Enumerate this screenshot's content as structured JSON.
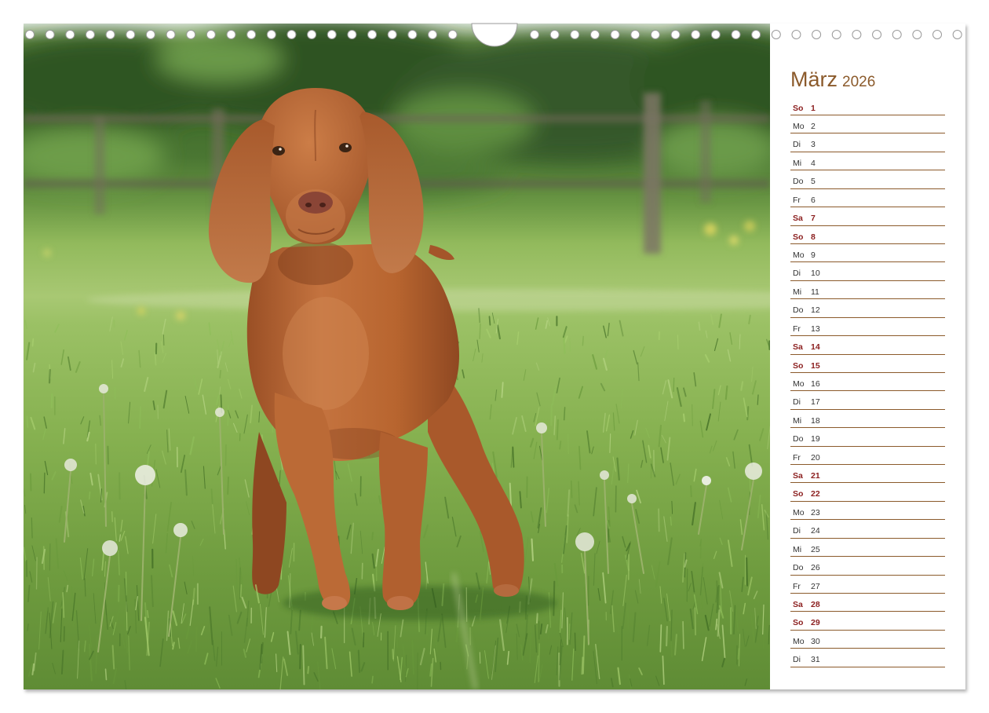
{
  "calendar": {
    "month": "März",
    "year": "2026",
    "days": [
      {
        "wd": "So",
        "d": "1",
        "weekend": true
      },
      {
        "wd": "Mo",
        "d": "2",
        "weekend": false
      },
      {
        "wd": "Di",
        "d": "3",
        "weekend": false
      },
      {
        "wd": "Mi",
        "d": "4",
        "weekend": false
      },
      {
        "wd": "Do",
        "d": "5",
        "weekend": false
      },
      {
        "wd": "Fr",
        "d": "6",
        "weekend": false
      },
      {
        "wd": "Sa",
        "d": "7",
        "weekend": true
      },
      {
        "wd": "So",
        "d": "8",
        "weekend": true
      },
      {
        "wd": "Mo",
        "d": "9",
        "weekend": false
      },
      {
        "wd": "Di",
        "d": "10",
        "weekend": false
      },
      {
        "wd": "Mi",
        "d": "11",
        "weekend": false
      },
      {
        "wd": "Do",
        "d": "12",
        "weekend": false
      },
      {
        "wd": "Fr",
        "d": "13",
        "weekend": false
      },
      {
        "wd": "Sa",
        "d": "14",
        "weekend": true
      },
      {
        "wd": "So",
        "d": "15",
        "weekend": true
      },
      {
        "wd": "Mo",
        "d": "16",
        "weekend": false
      },
      {
        "wd": "Di",
        "d": "17",
        "weekend": false
      },
      {
        "wd": "Mi",
        "d": "18",
        "weekend": false
      },
      {
        "wd": "Do",
        "d": "19",
        "weekend": false
      },
      {
        "wd": "Fr",
        "d": "20",
        "weekend": false
      },
      {
        "wd": "Sa",
        "d": "21",
        "weekend": true
      },
      {
        "wd": "So",
        "d": "22",
        "weekend": true
      },
      {
        "wd": "Mo",
        "d": "23",
        "weekend": false
      },
      {
        "wd": "Di",
        "d": "24",
        "weekend": false
      },
      {
        "wd": "Mi",
        "d": "25",
        "weekend": false
      },
      {
        "wd": "Do",
        "d": "26",
        "weekend": false
      },
      {
        "wd": "Fr",
        "d": "27",
        "weekend": false
      },
      {
        "wd": "Sa",
        "d": "28",
        "weekend": true
      },
      {
        "wd": "So",
        "d": "29",
        "weekend": true
      },
      {
        "wd": "Mo",
        "d": "30",
        "weekend": false
      },
      {
        "wd": "Di",
        "d": "31",
        "weekend": false
      }
    ]
  },
  "colors": {
    "title": "#8b5a2b",
    "rule": "#8b5a2b",
    "weekend": "#8b1e1e",
    "text": "#333333",
    "fur": "#b5602e"
  }
}
